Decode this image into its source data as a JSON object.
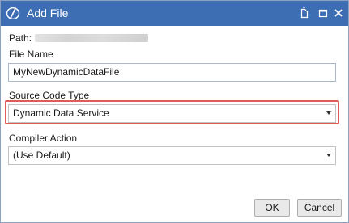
{
  "window": {
    "title": "Add File",
    "icon": "app-logo-icon",
    "controls": [
      "document-icon",
      "maximize-icon",
      "close-icon"
    ]
  },
  "form": {
    "path_label": "Path:",
    "file_name_label": "File Name",
    "file_name_value": "MyNewDynamicDataFile",
    "source_code_type_label": "Source Code Type",
    "source_code_type_value": "Dynamic Data Service",
    "compiler_action_label": "Compiler Action",
    "compiler_action_value": "(Use Default)"
  },
  "buttons": {
    "ok_label": "OK",
    "cancel_label": "Cancel"
  },
  "colors": {
    "titlebar": "#3d6db3",
    "highlight": "#e15a5a"
  }
}
